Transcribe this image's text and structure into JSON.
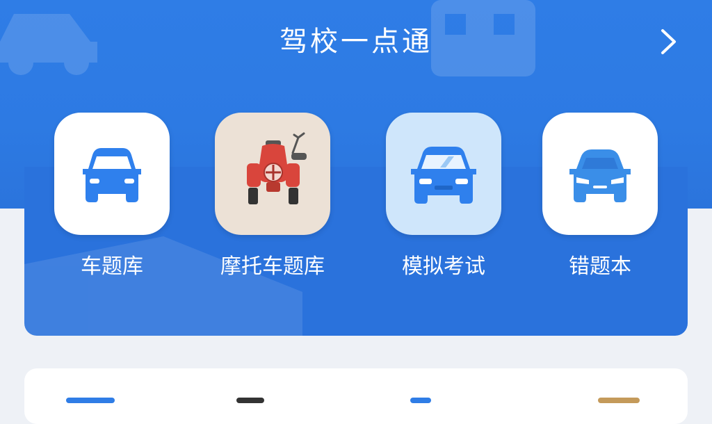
{
  "app": {
    "title": "驾校一点通"
  },
  "header": {
    "more_icon": "chevron-right-icon"
  },
  "menu": [
    {
      "label": "车题库",
      "icon": "car-front-icon",
      "bg": "#ffffff",
      "icon_color": "#2f80ed"
    },
    {
      "label": "摩托车题库",
      "icon": "motorcycle-icon",
      "bg": "#ece1d6",
      "icon_color": "#d9453c"
    },
    {
      "label": "模拟考试",
      "icon": "car-front-icon",
      "bg": "#cfe6fb",
      "icon_color": "#2f80ed"
    },
    {
      "label": "错题本",
      "icon": "car-front-icon",
      "bg": "#ffffff",
      "icon_color": "#3a8ee8"
    }
  ],
  "colors": {
    "primary": "#2f7de6",
    "panel": "#2a72dc",
    "background": "#eef1f6"
  }
}
